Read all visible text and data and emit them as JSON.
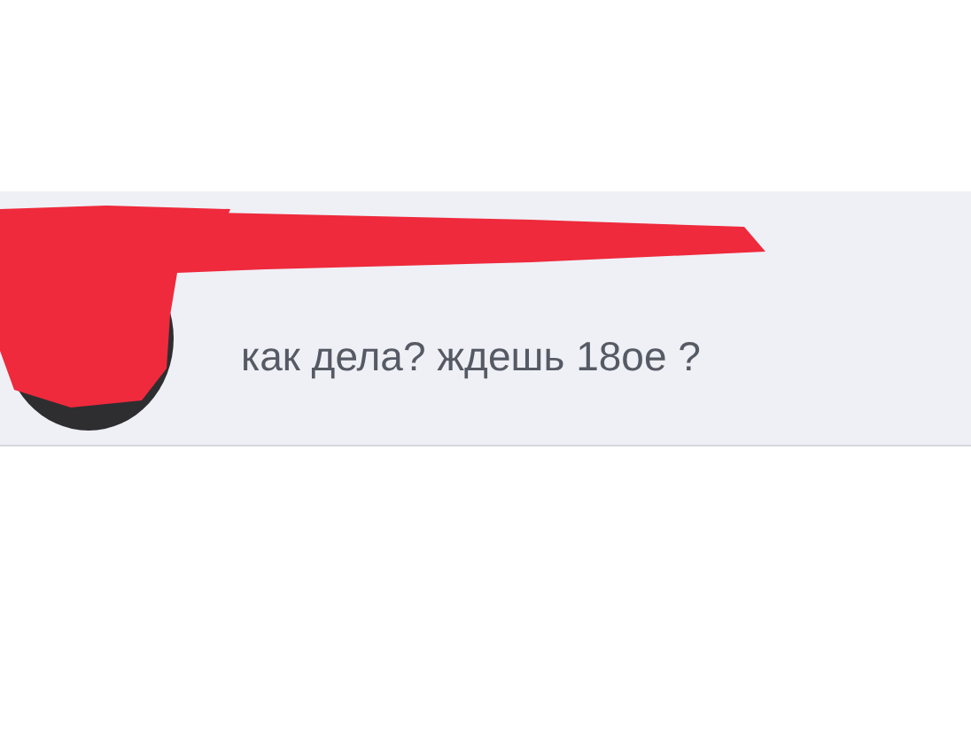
{
  "message": {
    "text": "как дела? ждешь 18ое ?",
    "redacted": true
  }
}
